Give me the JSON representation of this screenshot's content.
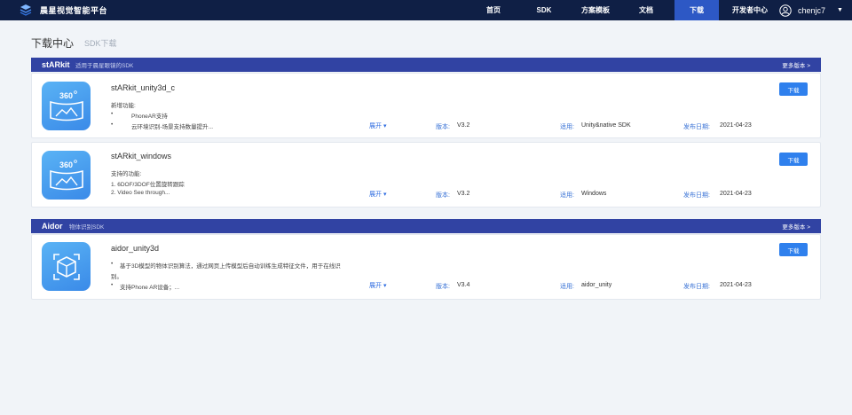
{
  "nav": {
    "brand": "晨星视觉智能平台",
    "items": [
      "首页",
      "SDK",
      "方案模板",
      "文档",
      "下载",
      "开发者中心"
    ],
    "active": "下载",
    "user": "chenjc7",
    "caret": "▼"
  },
  "page": {
    "title": "下载中心",
    "subtitle": "SDK下载"
  },
  "sections": [
    {
      "title": "stARkit",
      "desc": "适用于晨星眼镜的SDK",
      "more": "更多版本 >",
      "cards": [
        {
          "icon": "360-panorama-icon",
          "name": "stARkit_unity3d_c",
          "desc": [
            "新增功能:",
            "•",
            "PhoneAR支持",
            "•",
            "云环境识别-场景支持数量提升..."
          ],
          "expand": "展开 ▾",
          "version_label": "版本:",
          "version": "V3.2",
          "applies_label": "适用:",
          "applies": "Unity&native SDK",
          "date_label": "发布日期:",
          "date": "2021-04-23",
          "download": "下载"
        },
        {
          "icon": "360-panorama-icon",
          "name": "stARkit_windows",
          "desc": [
            "支持的功能:",
            "1. 6DOF/3DOF位置旋转跟踪",
            "2. Video See through..."
          ],
          "expand": "展开 ▾",
          "version_label": "版本:",
          "version": "V3.2",
          "applies_label": "适用:",
          "applies": "Windows",
          "date_label": "发布日期:",
          "date": "2021-04-23",
          "download": "下载"
        }
      ]
    },
    {
      "title": "Aidor",
      "desc": "物体识别SDK",
      "more": "更多版本 >",
      "cards": [
        {
          "icon": "3d-cube-scan-icon",
          "name": "aidor_unity3d",
          "desc": [
            "•",
            "基于3D模型的物体识别算法，通过网页上传模型后自动训练生成特征文件，用于在线识",
            "别。",
            "•",
            "支持Phone AR设备；..."
          ],
          "expand": "展开 ▾",
          "version_label": "版本:",
          "version": "V3.4",
          "applies_label": "适用:",
          "applies": "aidor_unity",
          "date_label": "发布日期:",
          "date": "2021-04-23",
          "download": "下载"
        }
      ]
    }
  ],
  "colors": {
    "nav_bg": "#0f1f45",
    "nav_active": "#2d58c5",
    "section_bar": "#3143a3",
    "button": "#2f80ed",
    "link": "#2d6be0"
  }
}
